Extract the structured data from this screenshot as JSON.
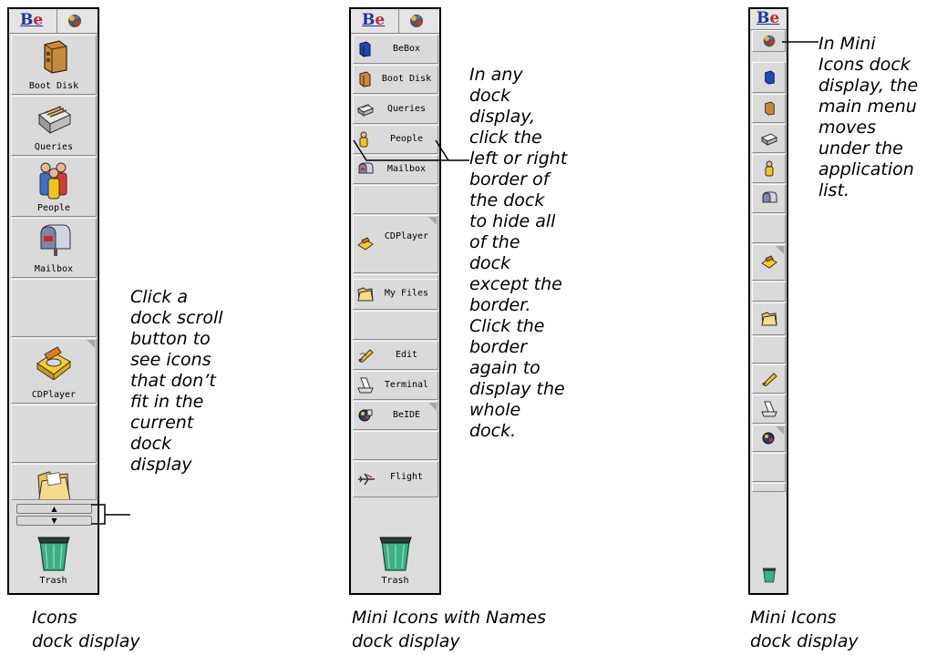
{
  "brand": {
    "b": "B",
    "e": "e"
  },
  "panel1": {
    "items": [
      {
        "label": "Boot Disk",
        "icon": "drive-icon"
      },
      {
        "label": "Queries",
        "icon": "queries-icon"
      },
      {
        "label": "People",
        "icon": "people-icon"
      },
      {
        "label": "Mailbox",
        "icon": "mailbox-icon"
      },
      {
        "label": "",
        "icon": ""
      },
      {
        "label": "CDPlayer",
        "icon": "cdplayer-icon"
      },
      {
        "label": "",
        "icon": ""
      },
      {
        "label": "",
        "icon": "folder-icon"
      }
    ],
    "scroll_up": "▲",
    "scroll_down": "▼",
    "trash_label": "Trash",
    "caption": "Icons\ndock display",
    "note": "Click a\ndock scroll\nbutton to\nsee icons\nthat don’t\nfit in the\ncurrent\ndock\ndisplay"
  },
  "panel2": {
    "items": [
      {
        "label": "BeBox",
        "icon": "bebox-icon"
      },
      {
        "label": "Boot Disk",
        "icon": "drive-icon"
      },
      {
        "label": "Queries",
        "icon": "queries-icon"
      },
      {
        "label": "People",
        "icon": "people-icon"
      },
      {
        "label": "Mailbox",
        "icon": "mailbox-icon"
      },
      {
        "label": "",
        "icon": ""
      },
      {
        "label": "CDPlayer",
        "icon": "cdplayer-icon"
      },
      {
        "label": "",
        "icon": ""
      },
      {
        "label": "My Files",
        "icon": "folder-icon"
      },
      {
        "label": "",
        "icon": ""
      },
      {
        "label": "Edit",
        "icon": "edit-icon"
      },
      {
        "label": "Terminal",
        "icon": "terminal-icon"
      },
      {
        "label": "BeIDE",
        "icon": "beide-icon"
      },
      {
        "label": "",
        "icon": ""
      },
      {
        "label": "Flight",
        "icon": "flight-icon"
      }
    ],
    "trash_label": "Trash",
    "caption": "Mini Icons with Names\ndock display",
    "note": "In any\ndock\ndisplay,\nclick the\nleft or right\nborder of\nthe dock\nto hide all\nof the\ndock\nexcept the\nborder.\nClick the\nborder\nagain to\ndisplay the\nwhole\ndock."
  },
  "panel3": {
    "items": [
      {
        "icon": "bebox-icon"
      },
      {
        "icon": "drive-icon"
      },
      {
        "icon": "queries-icon"
      },
      {
        "icon": "people-icon"
      },
      {
        "icon": "mailbox-icon"
      },
      {
        "icon": ""
      },
      {
        "icon": "cdplayer-icon"
      },
      {
        "icon": ""
      },
      {
        "icon": "folder-icon"
      },
      {
        "icon": ""
      },
      {
        "icon": "edit-icon"
      },
      {
        "icon": "terminal-icon"
      },
      {
        "icon": "beide-icon"
      },
      {
        "icon": ""
      },
      {
        "icon": ""
      }
    ],
    "caption": "Mini Icons\ndock display",
    "note": "In Mini\nIcons dock\ndisplay, the\nmain menu\nmoves\nunder the\napplication\n list."
  },
  "colors": {
    "be_blue": "#1b2fa0",
    "be_red": "#d4202a",
    "tile": "#dadada"
  }
}
